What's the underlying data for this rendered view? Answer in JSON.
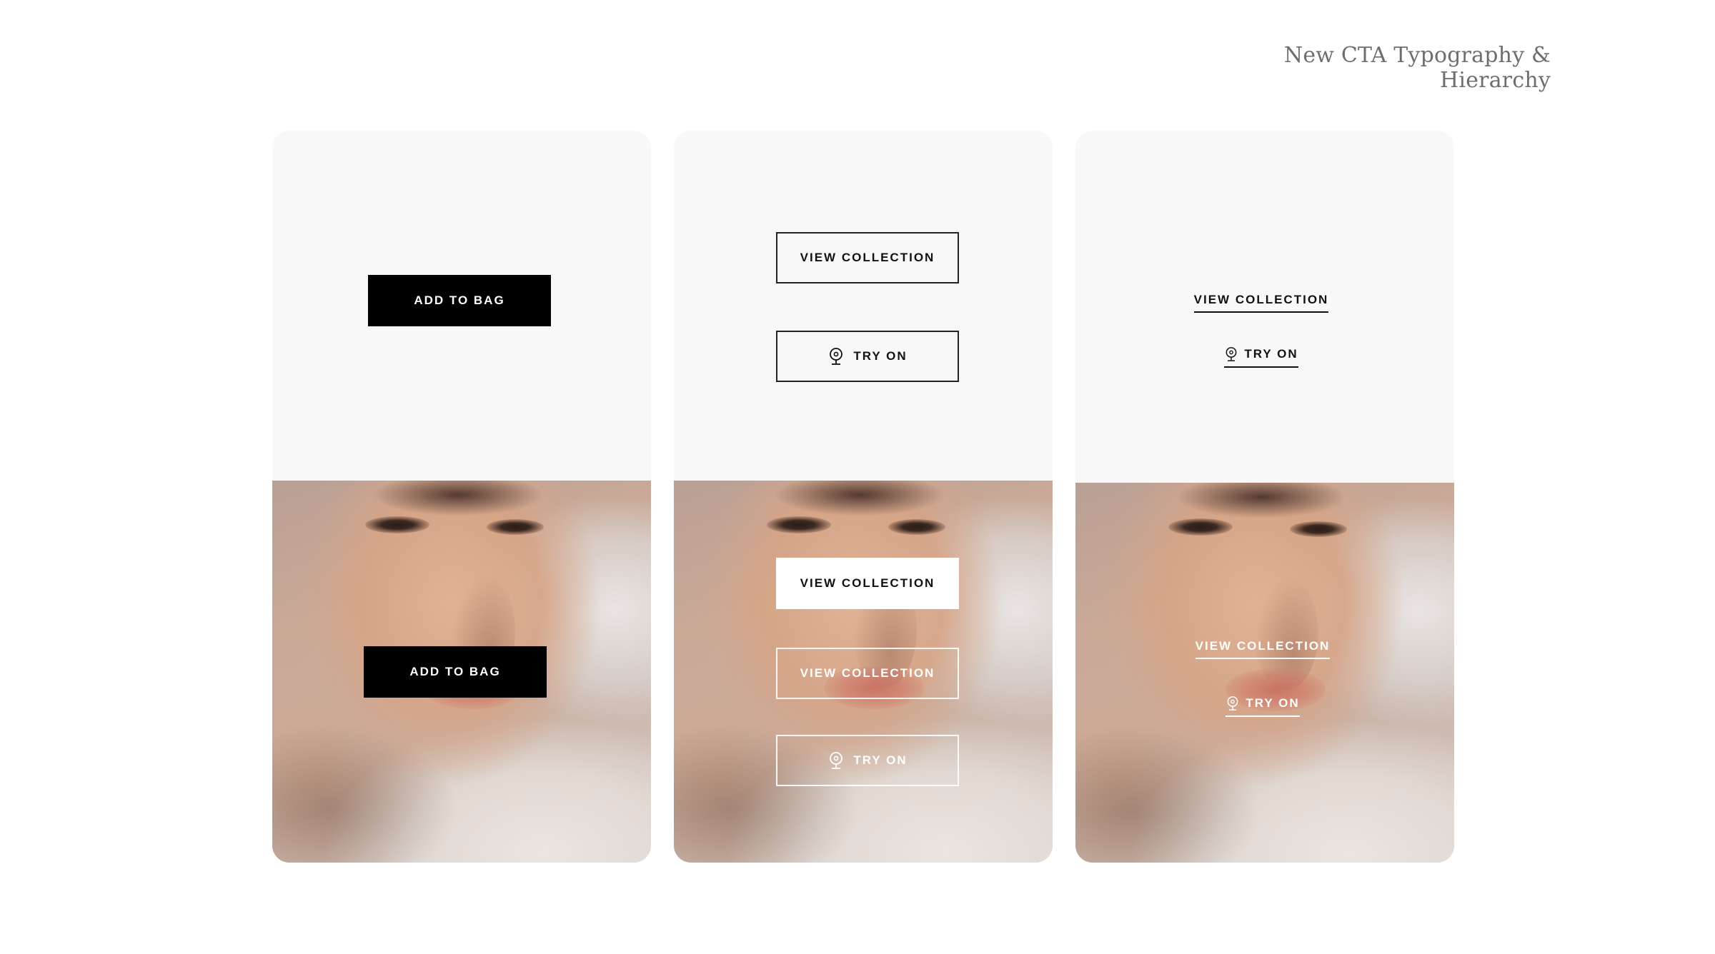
{
  "page": {
    "title": "New CTA Typography & Hierarchy"
  },
  "cards": [
    {
      "top": {
        "primary_label": "ADD TO BAG"
      },
      "bottom": {
        "primary_label": "ADD TO BAG"
      }
    },
    {
      "top": {
        "primary_label": "VIEW COLLECTION",
        "secondary_label": "TRY ON"
      },
      "bottom": {
        "primary_label": "VIEW COLLECTION",
        "outline_label": "VIEW COLLECTION",
        "secondary_label": "TRY ON"
      }
    },
    {
      "top": {
        "primary_label": "VIEW COLLECTION",
        "secondary_label": "TRY ON"
      },
      "bottom": {
        "primary_label": "VIEW COLLECTION",
        "secondary_label": "TRY ON"
      }
    }
  ],
  "icons": {
    "try_on": "webcam-icon"
  },
  "colors": {
    "solid_dark": "#000000",
    "outline_dark": "#222222",
    "light": "#ffffff",
    "card_bg": "#f8f8f8",
    "title": "#6e6e6e"
  }
}
